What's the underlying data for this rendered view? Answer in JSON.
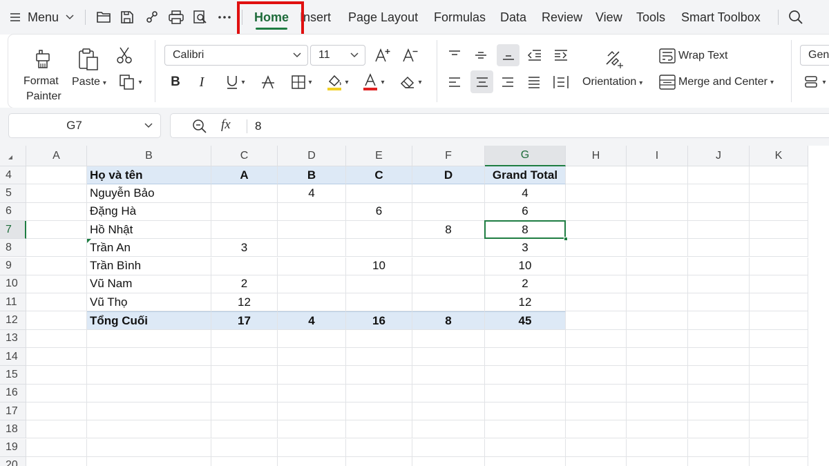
{
  "menubar": {
    "menu_label": "Menu",
    "tabs": [
      {
        "key": "home",
        "label": "Home",
        "active": true
      },
      {
        "key": "insert",
        "label": "Insert",
        "active": false
      },
      {
        "key": "page-layout",
        "label": "Page Layout",
        "active": false
      },
      {
        "key": "formulas",
        "label": "Formulas",
        "active": false
      },
      {
        "key": "data",
        "label": "Data",
        "active": false
      },
      {
        "key": "review",
        "label": "Review",
        "active": false
      },
      {
        "key": "view",
        "label": "View",
        "active": false
      },
      {
        "key": "tools",
        "label": "Tools",
        "active": false
      },
      {
        "key": "smart-toolbox",
        "label": "Smart Toolbox",
        "active": false
      }
    ],
    "icons": [
      "hamburger-icon",
      "folder-icon",
      "save-icon",
      "link-icon",
      "print-icon",
      "print-preview-icon",
      "more-icon",
      "search-icon"
    ]
  },
  "ribbon": {
    "format_painter_line1": "Format",
    "format_painter_line2": "Painter",
    "paste_label": "Paste",
    "font_name": "Calibri",
    "font_size": "11",
    "wrap_text_label": "Wrap Text",
    "orientation_label": "Orientation",
    "merge_center_label": "Merge and Center",
    "number_format_partial": "Gen",
    "underline_color": "#d11f1f",
    "highlight_color": "#f2d024",
    "font_color": "#e02020"
  },
  "formula_bar": {
    "name_box": "G7",
    "fx_label": "fx",
    "value": "8"
  },
  "sheet": {
    "columns": [
      "A",
      "B",
      "C",
      "D",
      "E",
      "F",
      "G",
      "H",
      "I",
      "J",
      "K"
    ],
    "selected_column": "G",
    "rows": [
      "4",
      "5",
      "6",
      "7",
      "8",
      "9",
      "10",
      "11",
      "12",
      "13",
      "14",
      "15",
      "16",
      "17",
      "18",
      "19",
      "20"
    ],
    "selected_row": "7",
    "pivot_header": [
      "Họ và tên",
      "A",
      "B",
      "C",
      "D",
      "Grand Total"
    ],
    "pivot_rows": [
      [
        "Nguyễn Bảo",
        "",
        "4",
        "",
        "",
        "4"
      ],
      [
        "Đặng Hà",
        "",
        "",
        "6",
        "",
        "6"
      ],
      [
        "Hồ Nhật",
        "",
        "",
        "",
        "8",
        "8"
      ],
      [
        "Trần An",
        "3",
        "",
        "",
        "",
        "3"
      ],
      [
        "Trần Bình",
        "",
        "",
        "10",
        "",
        "10"
      ],
      [
        "Vũ Nam",
        "2",
        "",
        "",
        "",
        "2"
      ],
      [
        "Vũ Thọ",
        "12",
        "",
        "",
        "",
        "12"
      ]
    ],
    "pivot_total": [
      "Tổng Cuối",
      "17",
      "4",
      "16",
      "8",
      "45"
    ]
  }
}
